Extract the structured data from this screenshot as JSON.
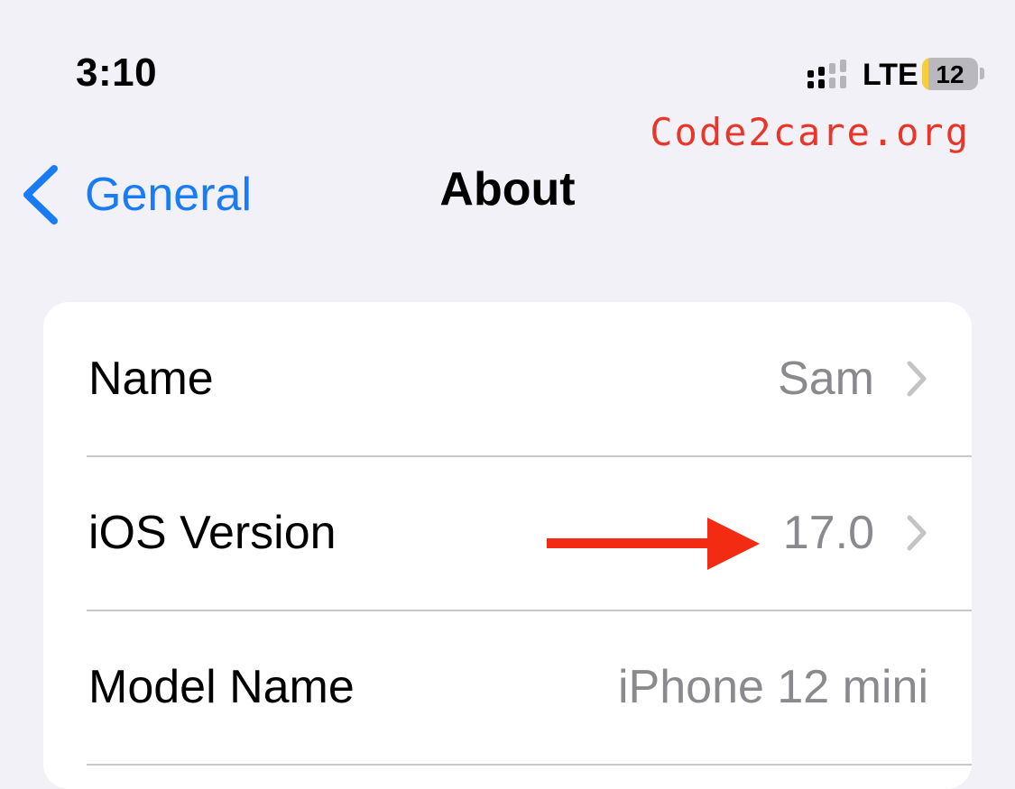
{
  "status_bar": {
    "time": "3:10",
    "network": "LTE",
    "battery_level": "12",
    "battery_fraction": 0.12,
    "signal_icon": "signal-bars-icon"
  },
  "watermark": "Code2care.org",
  "nav": {
    "back_label": "General",
    "title": "About",
    "back_icon": "chevron-left-icon"
  },
  "rows": [
    {
      "label": "Name",
      "value": "Sam",
      "has_chevron": true
    },
    {
      "label": "iOS Version",
      "value": "17.0",
      "has_chevron": true
    },
    {
      "label": "Model Name",
      "value": "iPhone 12 mini",
      "has_chevron": false
    }
  ],
  "annotation": {
    "type": "arrow",
    "points_to": "iOS Version value"
  },
  "colors": {
    "accent": "#1a7cf5",
    "background": "#f2f1f7",
    "card": "#ffffff",
    "secondary_text": "#8a8a8e",
    "watermark": "#e8372a",
    "arrow": "#f32b12",
    "battery_fill": "#f6cd3d"
  }
}
